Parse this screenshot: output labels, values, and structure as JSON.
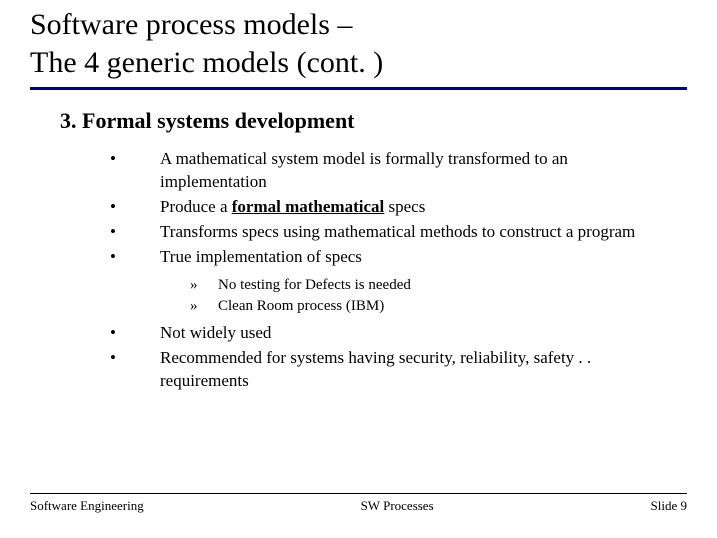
{
  "title_line1": "Software process models –",
  "title_line2": "The 4 generic models (cont. )",
  "section_heading": "3. Formal systems development",
  "bullets": {
    "b1": "A mathematical system model is formally transformed to an implementation",
    "b2_prefix": "Produce a ",
    "b2_emph": "formal mathematical",
    "b2_suffix": " specs",
    "b3": "Transforms specs using mathematical methods to construct a program",
    "b4": "True implementation of specs",
    "b5": "Not widely used",
    "b6": "Recommended for systems having security, reliability, safety . . requirements"
  },
  "sub": {
    "s1": "No testing for Defects  is needed",
    "s2": "Clean Room process (IBM)"
  },
  "footer": {
    "left": "Software Engineering",
    "center": "SW Processes",
    "right": "Slide 9"
  }
}
